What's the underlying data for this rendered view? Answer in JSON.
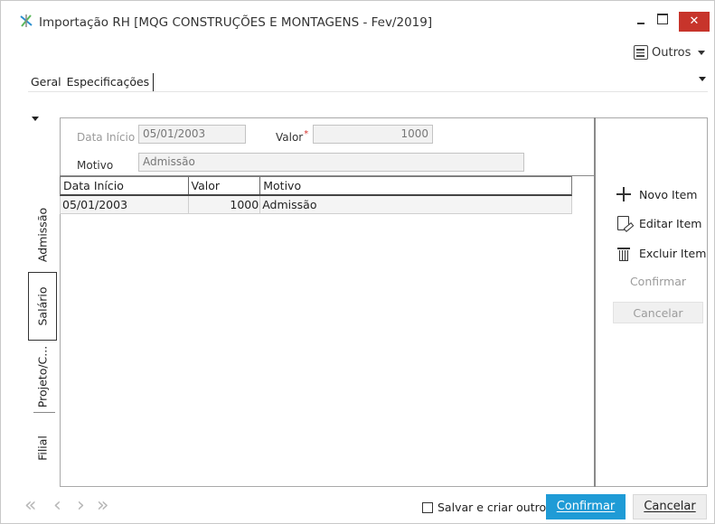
{
  "window": {
    "title": "Importação RH [MQG CONSTRUÇÕES E MONTAGENS - Fev/2019]",
    "close_glyph": "✕"
  },
  "toolbar": {
    "outros_label": "Outros"
  },
  "top_tabs": [
    {
      "label": "Geral"
    },
    {
      "label": "Especificações",
      "active": true
    }
  ],
  "side_tabs": [
    {
      "label": "Admissão"
    },
    {
      "label": "Salário",
      "active": true
    },
    {
      "label": "Projeto/C..."
    },
    {
      "label": "Filial"
    }
  ],
  "form": {
    "data_inicio_label": "Data Início",
    "data_inicio_value": "05/01/2003",
    "valor_label": "Valor",
    "valor_required": "*",
    "valor_value": "1000",
    "motivo_label": "Motivo",
    "motivo_value": "Admissão"
  },
  "grid": {
    "columns": [
      "Data Início",
      "Valor",
      "Motivo"
    ],
    "rows": [
      [
        "05/01/2003",
        "1000",
        "Admissão"
      ]
    ]
  },
  "actions": {
    "novo_item": "Novo Item",
    "editar_item": "Editar Item",
    "excluir_item": "Excluir Item",
    "confirmar": "Confirmar",
    "cancelar": "Cancelar"
  },
  "footer": {
    "nav_first": "«",
    "nav_prev": "‹",
    "nav_next": "›",
    "nav_last": "»",
    "save_and_new_label": "Salvar e criar outro",
    "confirm_label": "Confirmar",
    "cancel_label": "Cancelar"
  },
  "colors": {
    "confirm_button": "#1f9bd6",
    "close_button": "#c7342b",
    "required_marker": "#d6322d"
  }
}
